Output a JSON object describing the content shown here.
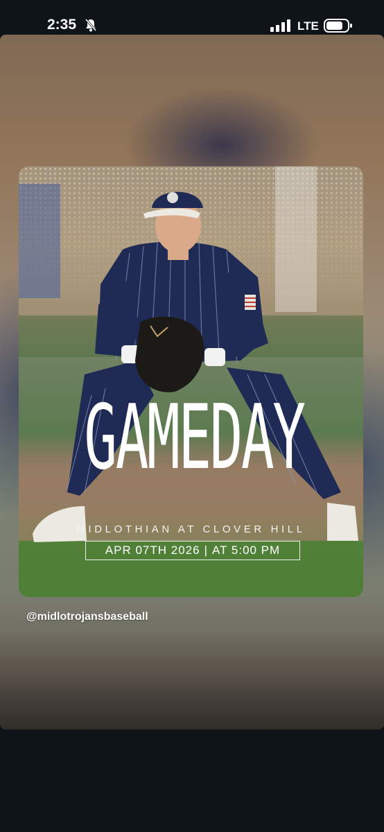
{
  "status_bar": {
    "time": "2:35",
    "network": "LTE",
    "icons": [
      "bell-slash-icon",
      "cellular-signal-icon",
      "battery-icon"
    ]
  },
  "post": {
    "title": "GAMEDAY",
    "matchup": "MIDLOTHIAN AT CLOVER HILL",
    "date": "APR 07TH 2026",
    "separator": "|",
    "time": "AT 5:00 PM"
  },
  "mention": {
    "username": "@midlotrojansbaseball"
  },
  "colors": {
    "uniform_navy": "#1f2a55",
    "background": "#0e1418"
  }
}
